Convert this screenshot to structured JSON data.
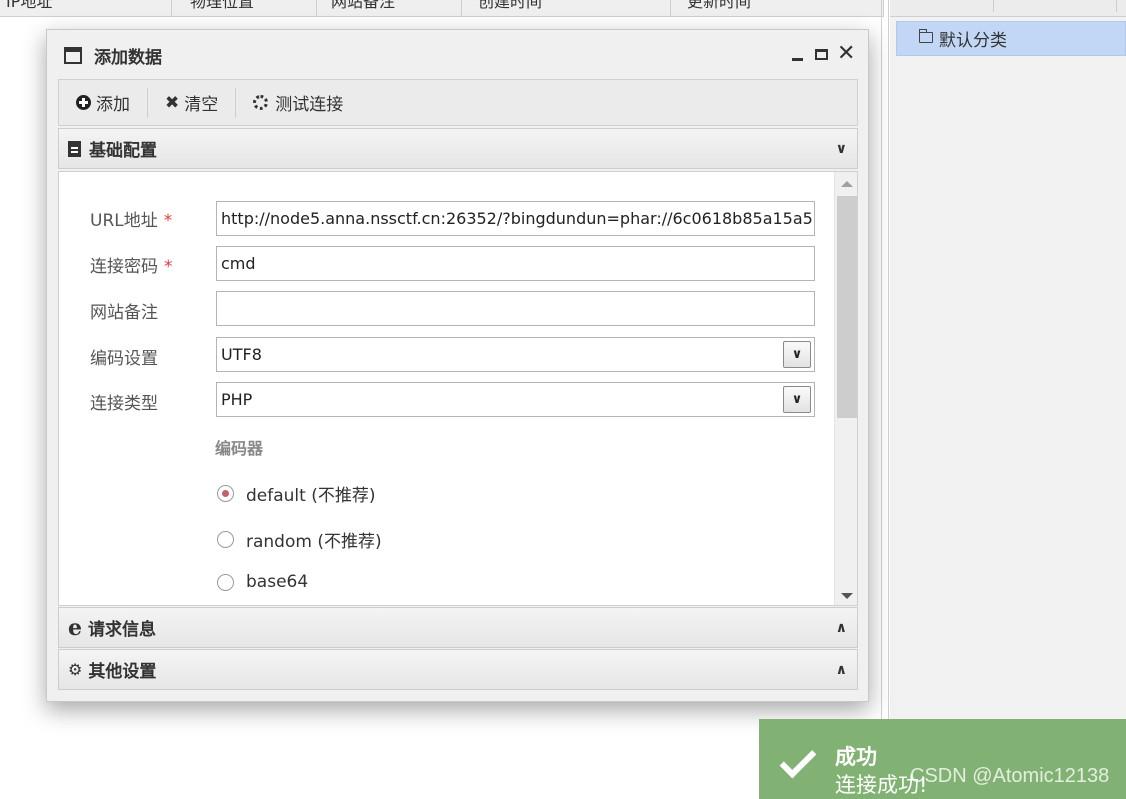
{
  "background": {
    "columns": [
      "IP地址",
      "物理位置",
      "网站备注",
      "创建时间",
      "更新时间"
    ],
    "category_tree": {
      "selected_item": "默认分类"
    }
  },
  "dialog": {
    "title": "添加数据",
    "toolbar": {
      "add_label": "添加",
      "clear_label": "清空",
      "test_label": "测试连接"
    },
    "sections": {
      "basic": "基础配置",
      "request": "请求信息",
      "other": "其他设置"
    },
    "form": {
      "url_label": "URL地址",
      "url_value": "http://node5.anna.nssctf.cn:26352/?bingdundun=phar://6c0618b85a15a5",
      "password_label": "连接密码",
      "password_value": "cmd",
      "note_label": "网站备注",
      "note_value": "",
      "encoding_label": "编码设置",
      "encoding_value": "UTF8",
      "type_label": "连接类型",
      "type_value": "PHP",
      "required_mark": "*",
      "encoder_title": "编码器",
      "encoders": [
        {
          "label": "default (不推荐)",
          "checked": true
        },
        {
          "label": "random (不推荐)",
          "checked": false
        },
        {
          "label": "base64",
          "checked": false
        }
      ]
    }
  },
  "toast": {
    "title": "成功",
    "message": "连接成功!"
  },
  "watermark": "CSDN @Atomic12138",
  "colors": {
    "toast_bg": "#82b273",
    "selected_bg": "#c2d7f5",
    "required": "#e03b3b",
    "radio_checked": "#c0616b"
  }
}
